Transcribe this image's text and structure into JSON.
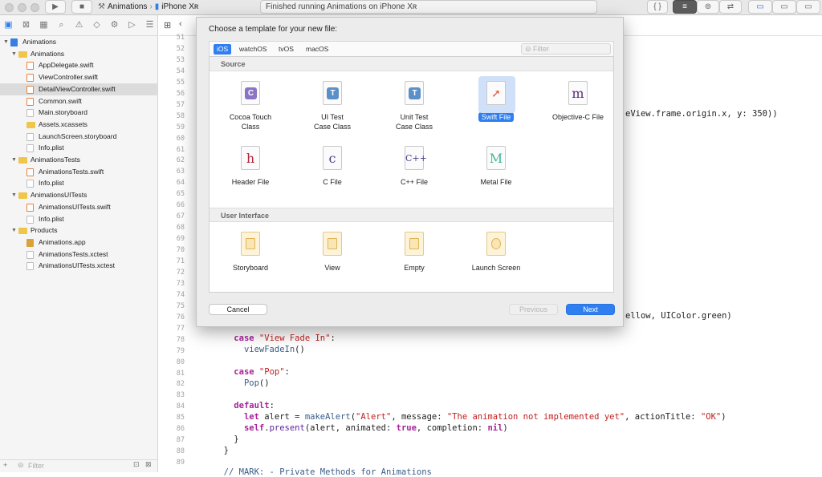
{
  "toolbar": {
    "scheme_project": "Animations",
    "scheme_device": "iPhone Xʀ",
    "activity_text": "Finished running Animations on iPhone Xʀ"
  },
  "navigator": {
    "filter_placeholder": "Filter",
    "items": [
      {
        "label": "Animations",
        "kind": "proj",
        "indent": 0,
        "disclosure": "▼"
      },
      {
        "label": "Animations",
        "kind": "folder",
        "indent": 1,
        "disclosure": "▼"
      },
      {
        "label": "AppDelegate.swift",
        "kind": "swift",
        "indent": 2,
        "disclosure": ""
      },
      {
        "label": "ViewController.swift",
        "kind": "swift",
        "indent": 2,
        "disclosure": ""
      },
      {
        "label": "DetailViewController.swift",
        "kind": "swift",
        "indent": 2,
        "disclosure": "",
        "selected": true
      },
      {
        "label": "Common.swift",
        "kind": "swift",
        "indent": 2,
        "disclosure": ""
      },
      {
        "label": "Main.storyboard",
        "kind": "file",
        "indent": 2,
        "disclosure": ""
      },
      {
        "label": "Assets.xcassets",
        "kind": "folder",
        "indent": 2,
        "disclosure": ""
      },
      {
        "label": "LaunchScreen.storyboard",
        "kind": "file",
        "indent": 2,
        "disclosure": ""
      },
      {
        "label": "Info.plist",
        "kind": "file",
        "indent": 2,
        "disclosure": ""
      },
      {
        "label": "AnimationsTests",
        "kind": "folder",
        "indent": 1,
        "disclosure": "▼"
      },
      {
        "label": "AnimationsTests.swift",
        "kind": "swift",
        "indent": 2,
        "disclosure": ""
      },
      {
        "label": "Info.plist",
        "kind": "file",
        "indent": 2,
        "disclosure": ""
      },
      {
        "label": "AnimationsUITests",
        "kind": "folder",
        "indent": 1,
        "disclosure": "▼"
      },
      {
        "label": "AnimationsUITests.swift",
        "kind": "swift",
        "indent": 2,
        "disclosure": ""
      },
      {
        "label": "Info.plist",
        "kind": "file",
        "indent": 2,
        "disclosure": ""
      },
      {
        "label": "Products",
        "kind": "folder",
        "indent": 1,
        "disclosure": "▼"
      },
      {
        "label": "Animations.app",
        "kind": "app",
        "indent": 2,
        "disclosure": ""
      },
      {
        "label": "AnimationsTests.xctest",
        "kind": "file",
        "indent": 2,
        "disclosure": ""
      },
      {
        "label": "AnimationsUITests.xctest",
        "kind": "file",
        "indent": 2,
        "disclosure": ""
      }
    ]
  },
  "editor": {
    "line_numbers": [
      "51",
      "52",
      "53",
      "54",
      "55",
      "56",
      "57",
      "58",
      "59",
      "60",
      "61",
      "62",
      "63",
      "64",
      "65",
      "66",
      "67",
      "68",
      "69",
      "70",
      "71",
      "72",
      "73",
      "74",
      "75",
      "76",
      "77",
      "78",
      "79",
      "80",
      "81",
      "82",
      "83",
      "84",
      "85",
      "86",
      "87",
      "88",
      "89"
    ],
    "partial_right_58": "eView.frame.origin.x, y: 350))",
    "partial_right_76": "ellow, UIColor.green)",
    "code": [
      {
        "line": 78,
        "tokens": [
          {
            "t": "    "
          },
          {
            "t": "case",
            "c": "kw"
          },
          {
            "t": " "
          },
          {
            "t": "\"View Fade In\"",
            "c": "str"
          },
          {
            "t": ":"
          }
        ]
      },
      {
        "line": 79,
        "tokens": [
          {
            "t": "      "
          },
          {
            "t": "viewFadeIn",
            "c": "fn"
          },
          {
            "t": "()"
          }
        ]
      },
      {
        "line": 81,
        "tokens": [
          {
            "t": "    "
          },
          {
            "t": "case",
            "c": "kw"
          },
          {
            "t": " "
          },
          {
            "t": "\"Pop\"",
            "c": "str"
          },
          {
            "t": ":"
          }
        ]
      },
      {
        "line": 82,
        "tokens": [
          {
            "t": "      "
          },
          {
            "t": "Pop",
            "c": "fn"
          },
          {
            "t": "()"
          }
        ]
      },
      {
        "line": 84,
        "tokens": [
          {
            "t": "    "
          },
          {
            "t": "default",
            "c": "kw"
          },
          {
            "t": ":"
          }
        ]
      },
      {
        "line": 85,
        "tokens": [
          {
            "t": "      "
          },
          {
            "t": "let",
            "c": "kw"
          },
          {
            "t": " alert = "
          },
          {
            "t": "makeAlert",
            "c": "fn"
          },
          {
            "t": "("
          },
          {
            "t": "\"Alert\"",
            "c": "str"
          },
          {
            "t": ", message: "
          },
          {
            "t": "\"The animation not implemented yet\"",
            "c": "str"
          },
          {
            "t": ", actionTitle: "
          },
          {
            "t": "\"OK\"",
            "c": "str"
          },
          {
            "t": ")"
          }
        ]
      },
      {
        "line": 86,
        "tokens": [
          {
            "t": "      "
          },
          {
            "t": "self",
            "c": "kw"
          },
          {
            "t": "."
          },
          {
            "t": "present",
            "c": "bg"
          },
          {
            "t": "(alert, animated: "
          },
          {
            "t": "true",
            "c": "kw"
          },
          {
            "t": ", completion: "
          },
          {
            "t": "nil",
            "c": "kw"
          },
          {
            "t": ")"
          }
        ]
      },
      {
        "line": 87,
        "tokens": [
          {
            "t": "    }"
          }
        ]
      },
      {
        "line": 88,
        "tokens": [
          {
            "t": "  }"
          }
        ]
      },
      {
        "line": 90,
        "tokens": [
          {
            "t": "  "
          },
          {
            "t": "// MARK: - Private Methods for Animations",
            "c": "fn"
          }
        ]
      }
    ]
  },
  "sheet": {
    "title": "Choose a template for your new file:",
    "platforms": [
      {
        "label": "iOS",
        "active": true
      },
      {
        "label": "watchOS"
      },
      {
        "label": "tvOS"
      },
      {
        "label": "macOS"
      }
    ],
    "filter_placeholder": "Filter",
    "section_source": "Source",
    "section_ui": "User Interface",
    "source_templates": [
      {
        "line1": "Cocoa Touch",
        "line2": "Class",
        "glyph": "C",
        "icon": "cocoa-touch-class-icon",
        "color": "#8a74c4"
      },
      {
        "line1": "UI Test",
        "line2": "Case Class",
        "glyph": "T",
        "icon": "ui-test-case-class-icon",
        "color": "#5b8fc8"
      },
      {
        "line1": "Unit Test",
        "line2": "Case Class",
        "glyph": "T",
        "icon": "unit-test-case-class-icon",
        "color": "#5b8fc8"
      },
      {
        "line1": "Swift File",
        "line2": "",
        "glyph": "➚",
        "icon": "swift-file-icon",
        "color": "#f05138",
        "selected": true
      },
      {
        "line1": "Objective-C File",
        "line2": "",
        "glyph": "m",
        "icon": "objective-c-file-icon",
        "color": "#5a2a7c"
      },
      {
        "line1": "Header File",
        "line2": "",
        "glyph": "h",
        "icon": "header-file-icon",
        "color": "#b0253d"
      },
      {
        "line1": "C File",
        "line2": "",
        "glyph": "c",
        "icon": "c-file-icon",
        "color": "#4a3c8c"
      },
      {
        "line1": "C++ File",
        "line2": "",
        "glyph": "C++",
        "icon": "cpp-file-icon",
        "color": "#4a3c8c"
      },
      {
        "line1": "Metal File",
        "line2": "",
        "glyph": "M",
        "icon": "metal-file-icon",
        "color": "#3fb79b"
      }
    ],
    "ui_templates": [
      {
        "line1": "Storyboard",
        "icon": "storyboard-icon"
      },
      {
        "line1": "View",
        "icon": "view-xib-icon"
      },
      {
        "line1": "Empty",
        "icon": "empty-file-icon"
      },
      {
        "line1": "Launch Screen",
        "icon": "launch-screen-icon"
      }
    ],
    "cancel_label": "Cancel",
    "previous_label": "Previous",
    "next_label": "Next"
  }
}
